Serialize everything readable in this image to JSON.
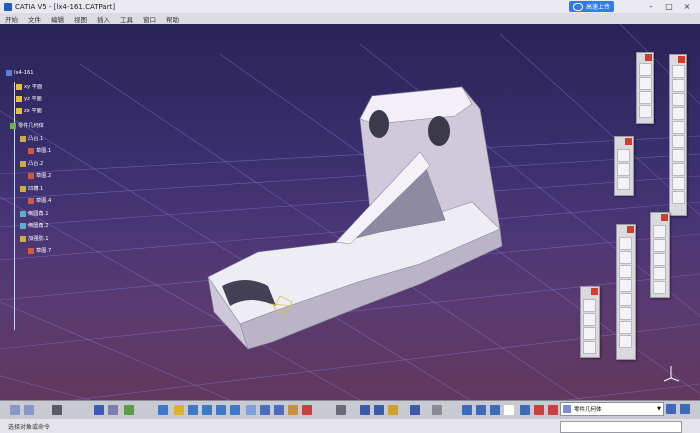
{
  "window": {
    "title": "CATIA V5 - [lx4-161.CATPart]",
    "cloud_button": "高速上传"
  },
  "menu": [
    "开始",
    "文件",
    "编辑",
    "视图",
    "插入",
    "工具",
    "窗口",
    "帮助"
  ],
  "tree": {
    "root": "lx4-161",
    "items": [
      {
        "label": "xy 平面",
        "icon": "plane-icon",
        "level": 1
      },
      {
        "label": "yz 平面",
        "icon": "plane-icon",
        "level": 1
      },
      {
        "label": "zx 平面",
        "icon": "plane-icon",
        "level": 1
      },
      {
        "label": "零件几何体",
        "icon": "body-icon",
        "level": 1
      },
      {
        "label": "凸台.1",
        "icon": "pad-icon",
        "level": 2
      },
      {
        "label": "草图.1",
        "icon": "sketch-icon",
        "level": 3
      },
      {
        "label": "凸台.2",
        "icon": "pad-icon",
        "level": 2
      },
      {
        "label": "草图.2",
        "icon": "sketch-icon",
        "level": 3
      },
      {
        "label": "凹槽.1",
        "icon": "pocket-icon",
        "level": 2
      },
      {
        "label": "草图.4",
        "icon": "sketch-icon",
        "level": 3
      },
      {
        "label": "倒圆角.1",
        "icon": "fillet-icon",
        "level": 2
      },
      {
        "label": "倒圆角.2",
        "icon": "fillet-icon",
        "level": 2
      },
      {
        "label": "加强肋.1",
        "icon": "rib-icon",
        "level": 2
      },
      {
        "label": "草图.7",
        "icon": "sketch-icon",
        "level": 3
      }
    ]
  },
  "current_body": "零件几何体",
  "status": "选择对象或命令",
  "colors": {
    "toolbar_bg": "#d9d9de",
    "close_red": "#d23c2a",
    "part_surface": "#e8e6ee"
  }
}
